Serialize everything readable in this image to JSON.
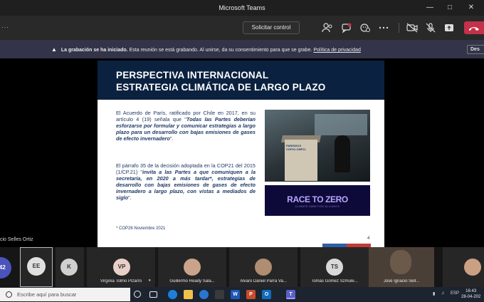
{
  "window": {
    "title": "Microsoft Teams"
  },
  "toolbar": {
    "request_control_label": "Solicitar control"
  },
  "banner": {
    "heading": "La grabación se ha iniciado.",
    "message": "Esta reunión se está grabando. Al unirse, da su consentimiento para que se grabe.",
    "link": "Política de privacidad",
    "dismiss": "Des"
  },
  "slide": {
    "title_line1": "PERSPECTIVA INTERNACIONAL",
    "title_line2": "ESTRATEGIA CLIMÁTICA DE LARGO PLAZO",
    "para1_plain": "El Acuerdo de París, ratificado por Chile en 2017, en su artículo 4 (19) señala que \"",
    "para1_bold": "Todas las Partes deberían esforzarse por formular y comunicar estrategias a largo plazo para un desarrollo con bajas emisiones de gases de efecto invernadero",
    "para1_end": "\".",
    "para2_plain": "El párrafo 35 de la decisión adoptada en la COP21 del 2015 (1/CP.21) \"",
    "para2_bold": "invita a las Partes a que comuniquen a la secretaría, en 2020 a más tardar*, estrategias de desarrollo con bajas emisiones de gases de efecto invernadero a largo plazo, con vistas a mediados de siglo",
    "para2_end": "\".",
    "footnote": "* COP26 Noviembre 2021",
    "page_number": "4",
    "podium_label": "PARIS2015 COP21·CMP11",
    "race_title": "RACE TO ZERO",
    "race_subtitle": "CLIMATE AMBITION ALLIANCE"
  },
  "presenter": {
    "name": "cio Selles Ortiz"
  },
  "participants": {
    "overflow": "+42",
    "items": [
      {
        "initials": "EE",
        "name": "",
        "color": "#e0e0e0"
      },
      {
        "initials": "K",
        "name": "",
        "color": "#d0d0d0"
      },
      {
        "initials": "VP",
        "name": "Virginia Tolmo Pizarro",
        "color": "#e8cfc8"
      },
      {
        "initials": "",
        "name": "Guillermo Ready Sala...",
        "color": "#c9a48a"
      },
      {
        "initials": "",
        "name": "Alvaro Daniel Parra Va...",
        "color": "#b08c70"
      },
      {
        "initials": "TS",
        "name": "Tomás Gómez Szmule...",
        "color": "#d8d8d8"
      },
      {
        "initials": "",
        "name": "José Ignacio Sell...",
        "color": "#6b5a4a"
      },
      {
        "initials": "",
        "name": "",
        "color": "#caa083"
      }
    ]
  },
  "taskbar": {
    "search_placeholder": "Escribe aquí para buscar",
    "language": "ESP",
    "time": "16:43",
    "date": "28-04-202"
  }
}
